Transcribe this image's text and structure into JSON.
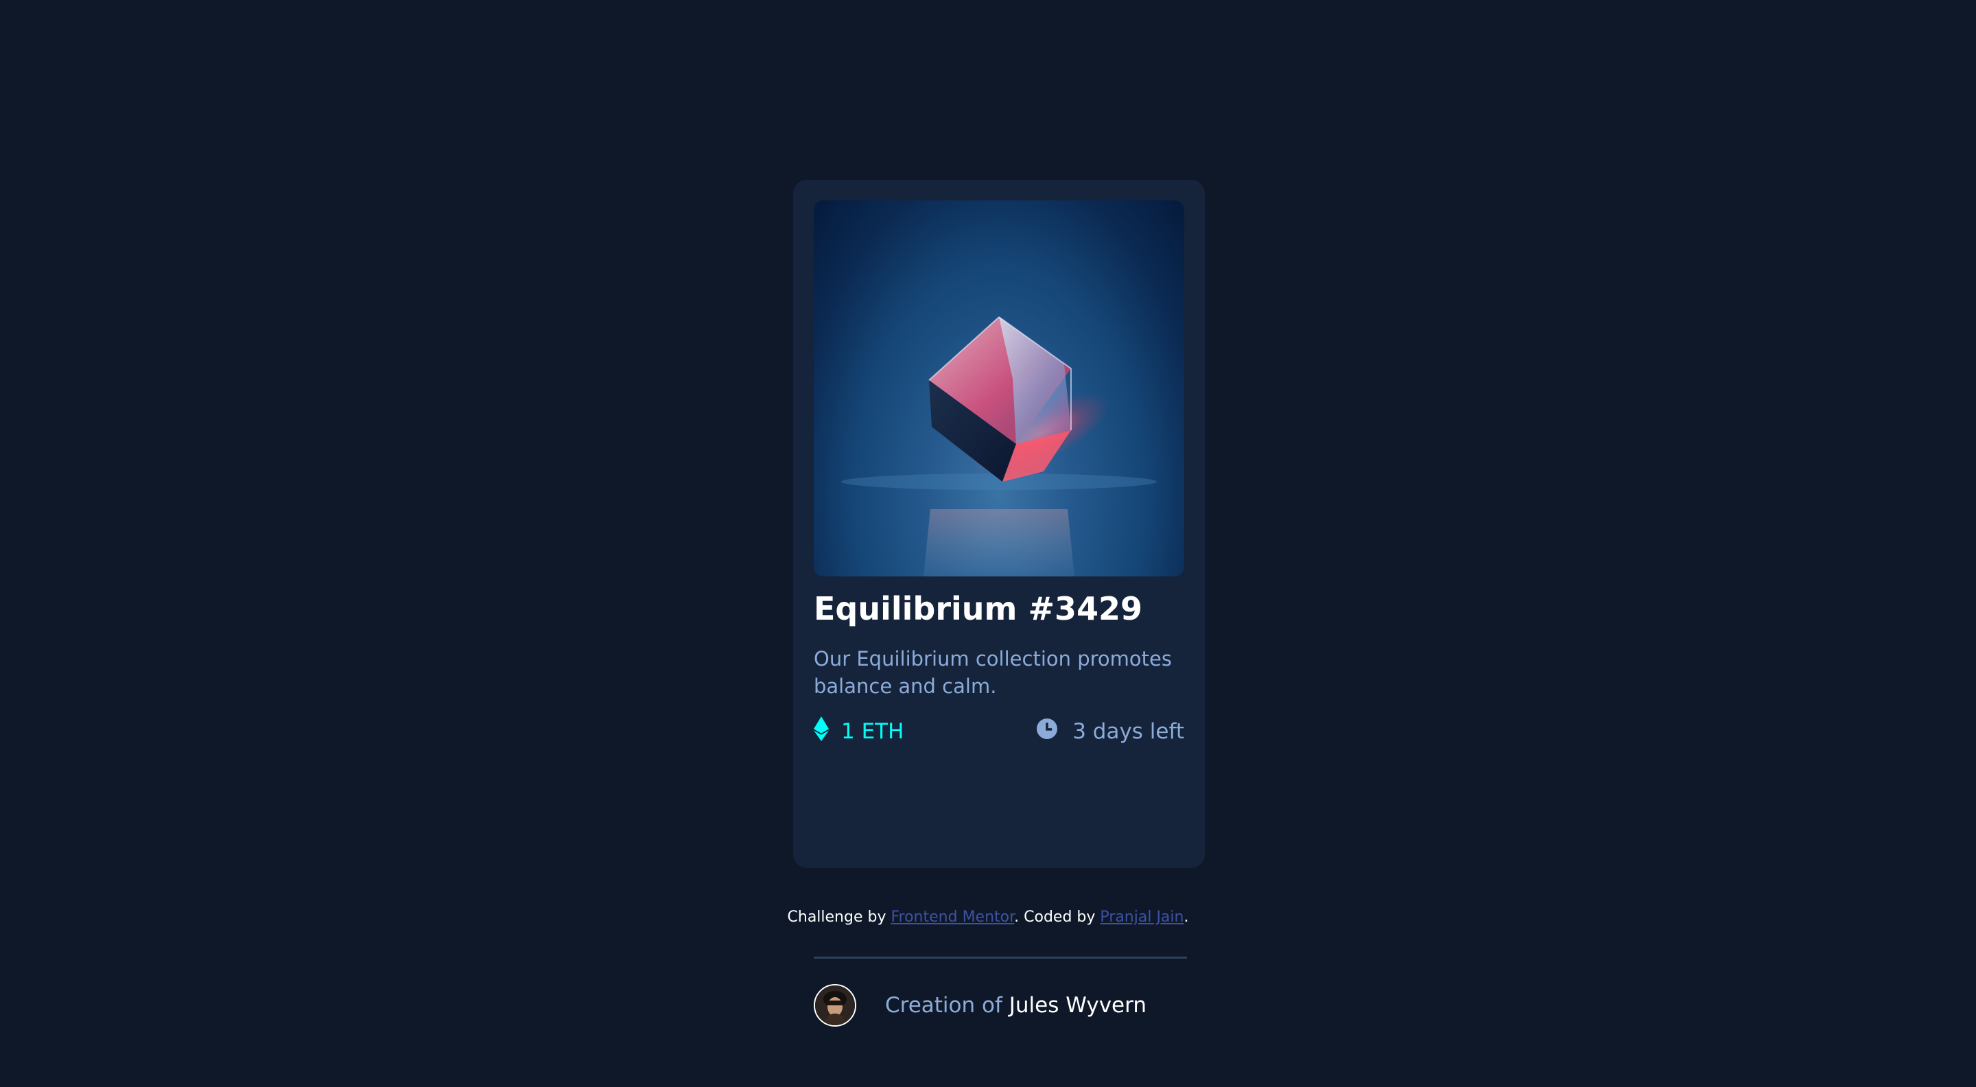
{
  "card": {
    "title": "Equilibrium #3429",
    "description": "Our Equilibrium collection promotes balance and calm.",
    "price": "1 ETH",
    "time_left": "3 days left",
    "creator_prefix": "Creation of",
    "creator_name": "Jules Wyvern"
  },
  "attribution": {
    "challenge_prefix": "Challenge by",
    "challenge_link": "Frontend Mentor",
    "coded_prefix": ". Coded by",
    "coded_link": "Pranjal Jain",
    "suffix": "."
  },
  "icons": {
    "price": "ethereum-icon",
    "time": "clock-icon"
  },
  "colors": {
    "page_background": "#0f1829",
    "card_background": "#15233b",
    "accent_cyan": "#00fff8",
    "soft_blue": "#8bacd9",
    "link_blue": "#3e52a3",
    "divider": "#2e405a"
  }
}
